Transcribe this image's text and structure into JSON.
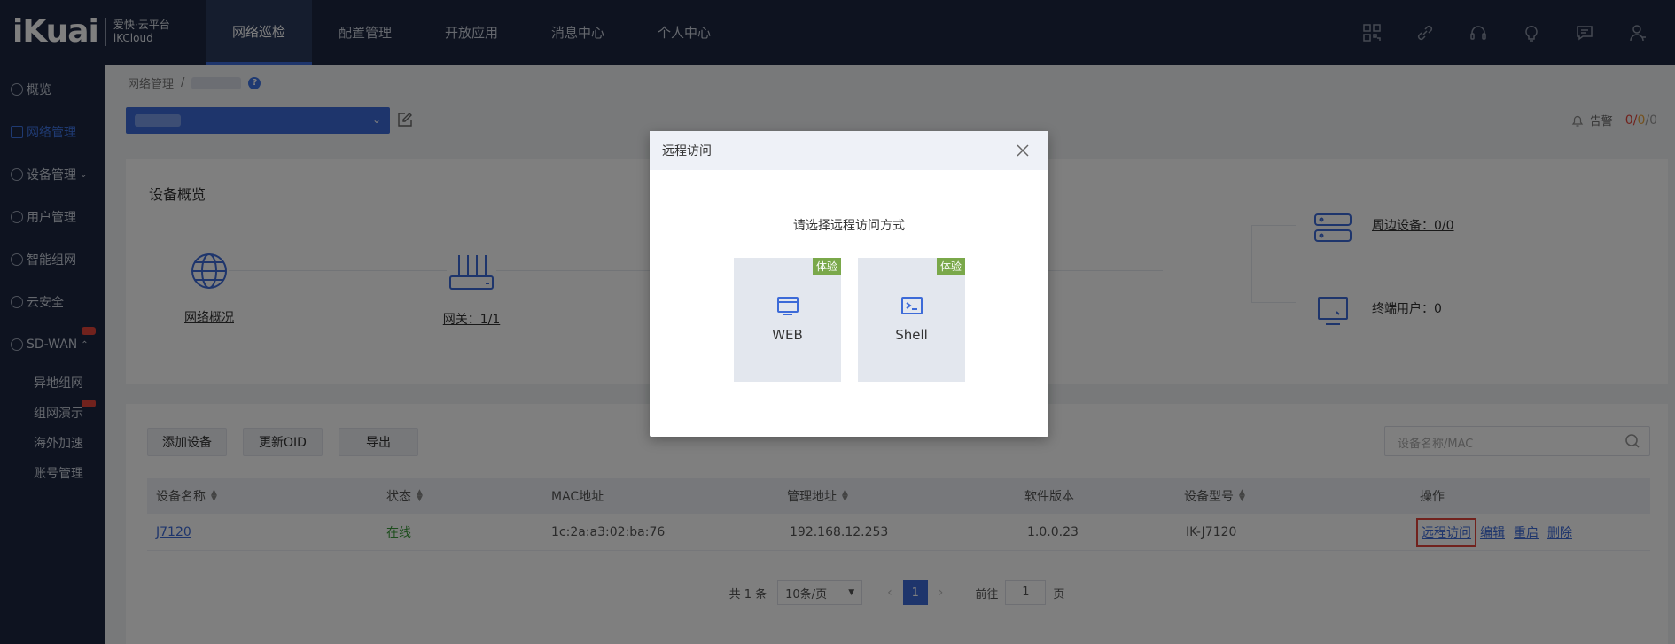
{
  "brand": {
    "name": "iKuai",
    "sub_cn": "爱快·云平台",
    "sub_en": "iKCloud"
  },
  "topnav": [
    {
      "label": "网络巡检",
      "active": true
    },
    {
      "label": "配置管理"
    },
    {
      "label": "开放应用"
    },
    {
      "label": "消息中心"
    },
    {
      "label": "个人中心"
    }
  ],
  "topicons": [
    "qrcode-icon",
    "link-icon",
    "headset-icon",
    "lightbulb-icon",
    "message-icon",
    "user-icon"
  ],
  "sidebar": {
    "items": [
      {
        "label": "概览",
        "icon": "dashboard-icon"
      },
      {
        "label": "网络管理",
        "icon": "network-icon",
        "active": true
      },
      {
        "label": "设备管理",
        "icon": "device-icon",
        "chevron": "⌄"
      },
      {
        "label": "用户管理",
        "icon": "user-icon"
      },
      {
        "label": "智能组网",
        "icon": "mesh-icon"
      },
      {
        "label": "云安全",
        "icon": "shield-icon"
      },
      {
        "label": "SD-WAN",
        "icon": "globe-icon",
        "chevron": "⌃"
      }
    ],
    "subitems": [
      {
        "label": "异地组网"
      },
      {
        "label": "组网演示"
      },
      {
        "label": "海外加速"
      },
      {
        "label": "账号管理"
      }
    ]
  },
  "breadcrumb": {
    "root": "网络管理",
    "sep": "/",
    "help": "?"
  },
  "alarm": {
    "label": "告警",
    "red": "0",
    "yellow": "0",
    "gray": "0",
    "slash": "/"
  },
  "overview": {
    "title": "设备概览",
    "items": [
      {
        "label": "网络概况"
      },
      {
        "label": "网关：1/1"
      }
    ],
    "peripheral": "周边设备：0/0",
    "terminal": "终端用户：0"
  },
  "table": {
    "buttons": [
      "添加设备",
      "更新OID",
      "导出"
    ],
    "search_placeholder": "设备名称/MAC",
    "headers": [
      "设备名称",
      "状态",
      "MAC地址",
      "管理地址",
      "软件版本",
      "设备型号",
      "操作"
    ],
    "rows": [
      {
        "name": "J7120",
        "status": "在线",
        "mac": "1c:2a:a3:02:ba:76",
        "ip": "192.168.12.253",
        "version": "1.0.0.23",
        "model": "IK-J7120",
        "ops": [
          "远程访问",
          "编辑",
          "重启",
          "删除"
        ]
      }
    ],
    "pager": {
      "total": "共 1 条",
      "per_page": "10条/页",
      "page": "1",
      "goto": "前往",
      "goto_value": "1",
      "page_unit": "页",
      "prev": "‹",
      "next": "›"
    }
  },
  "modal": {
    "title": "远程访问",
    "prompt": "请选择远程访问方式",
    "options": [
      {
        "label": "WEB",
        "badge": "体验",
        "icon": "browser-icon"
      },
      {
        "label": "Shell",
        "badge": "体验",
        "icon": "terminal-icon"
      }
    ]
  },
  "colors": {
    "nav_bg": "#1c2740",
    "accent": "#3d6bd8",
    "highlight": "#e2443a",
    "badge": "#7aa84a"
  }
}
